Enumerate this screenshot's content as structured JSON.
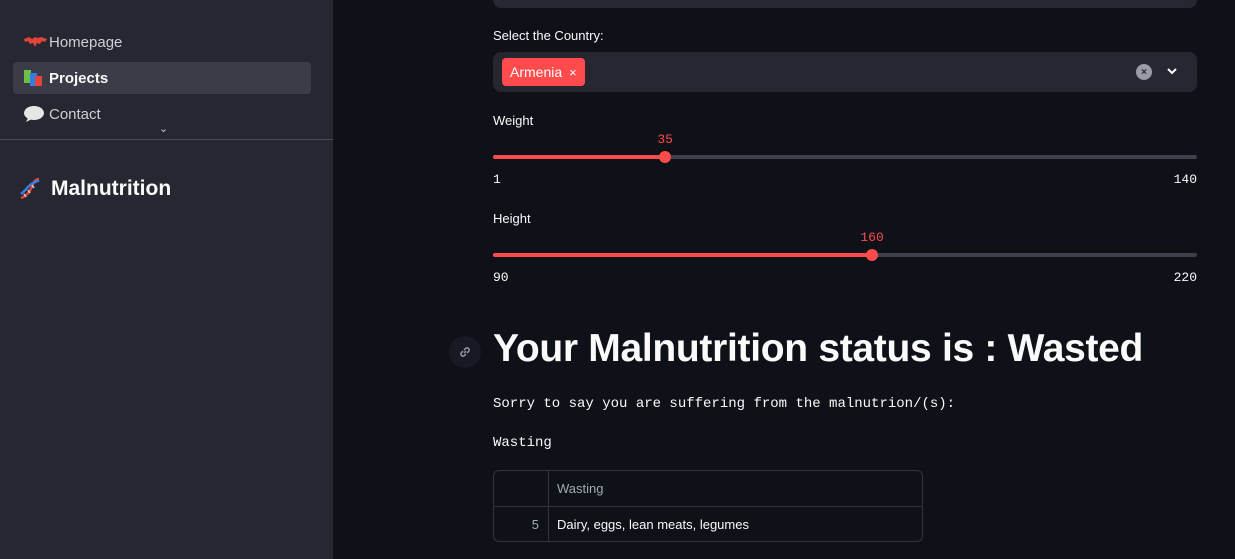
{
  "sidebar": {
    "nav": [
      {
        "label": "Homepage",
        "icon": "world-map-icon"
      },
      {
        "label": "Projects",
        "icon": "books-icon"
      },
      {
        "label": "Contact",
        "icon": "speech-bubble-icon"
      }
    ],
    "title": "Malnutrition",
    "title_icon": "dna-icon"
  },
  "form": {
    "country_label": "Select the Country:",
    "country_selected": "Armenia",
    "tag_remove": "×",
    "clear_glyph": "×",
    "weight": {
      "label": "Weight",
      "value": "35",
      "min": "1",
      "max": "140",
      "value_num": 35,
      "min_num": 1,
      "max_num": 140
    },
    "height": {
      "label": "Height",
      "value": "160",
      "min": "90",
      "max": "220",
      "value_num": 160,
      "min_num": 90,
      "max_num": 220
    }
  },
  "result": {
    "heading": "Your Malnutrition status is : Wasted",
    "message": "Sorry to say you are suffering from the malnutrion/(s):",
    "condition": "Wasting",
    "table": {
      "header": "Wasting",
      "rows": [
        {
          "index": "5",
          "value": "Dairy, eggs, lean meats, legumes"
        }
      ]
    }
  },
  "colors": {
    "accent": "#ff4b4b",
    "sidebar_bg": "#262730",
    "main_bg": "#0e1117"
  }
}
